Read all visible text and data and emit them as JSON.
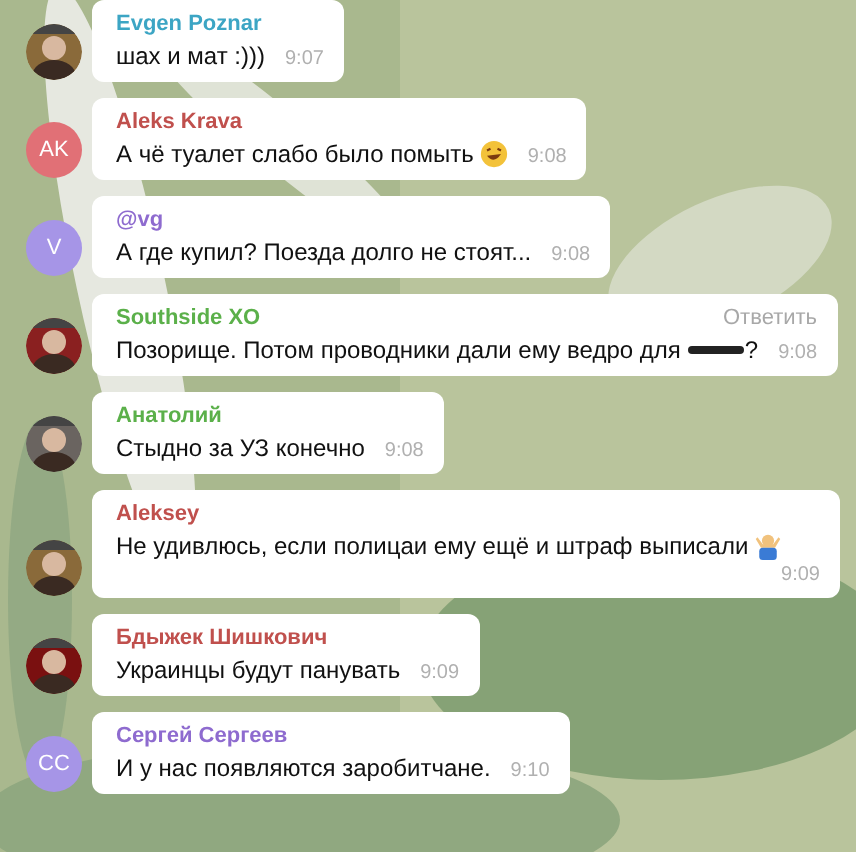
{
  "messages": [
    {
      "name": "Evgen Poznar",
      "color": "#3ca5c4",
      "text": "шах и мат :)))",
      "time": "9:07"
    },
    {
      "name": "Aleks Krava",
      "color": "#c0504d",
      "avatar": {
        "kind": "initials",
        "initials": "AK",
        "color": "#e17076"
      },
      "text": "А чё туалет слабо было помыть",
      "emoji": {
        "kind": "face"
      },
      "time": "9:08"
    },
    {
      "name": "@vg",
      "color": "#8e6bcf",
      "avatar": {
        "kind": "initials",
        "initials": "V",
        "color": "#a695e7"
      },
      "text": "А где купил? Поезда долго не стоят...",
      "time": "9:08"
    },
    {
      "name": "Southside XO",
      "color": "#5bb04a",
      "reply_label": "Ответить",
      "text": "Позорище. Потом проводники дали ему ведро для",
      "redacted": true,
      "text_after": "?",
      "time": "9:08"
    },
    {
      "name": "Анатолий",
      "color": "#5bb04a",
      "text": "Стыдно за УЗ конечно",
      "time": "9:08"
    },
    {
      "name": "Aleksey",
      "color": "#c0504d",
      "text": "Не удивлюсь, если полицаи ему ещё и штраф выписали",
      "emoji": {
        "kind": "figure"
      },
      "time": "9:09"
    },
    {
      "name": "Бдыжек Шишкович",
      "color": "#c0504d",
      "text": "Украинцы будут панувать",
      "time": "9:09"
    },
    {
      "name": "Сергей Сергеев",
      "color": "#8e6bcf",
      "avatar": {
        "kind": "initials",
        "initials": "CC",
        "color": "#a695e7"
      },
      "text": "И у нас появляются заробитчане.",
      "time": "9:10"
    }
  ]
}
